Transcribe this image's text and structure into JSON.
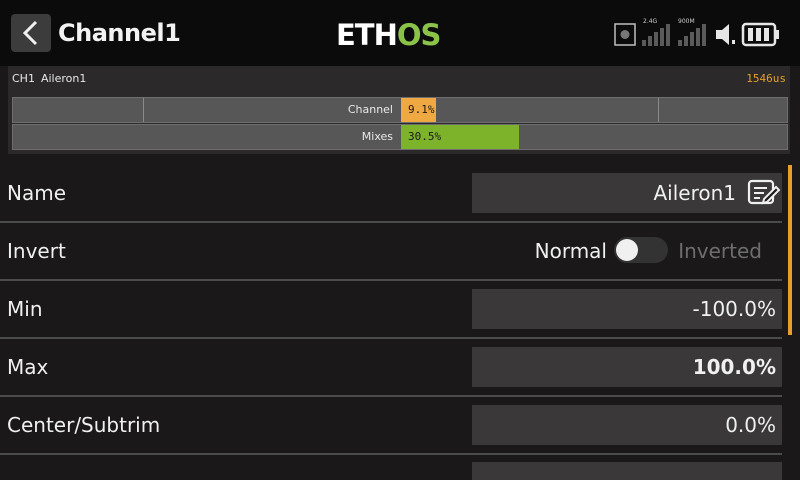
{
  "header": {
    "title": "Channel1",
    "logo": {
      "text": "ETHOS",
      "eth": "ETH",
      "os": "OS"
    },
    "status": {
      "rf_label": "2.4G",
      "rf2_label": "900M"
    }
  },
  "monitor": {
    "channel": "CH1",
    "name": "Aileron1",
    "output_us": "1546us",
    "bars": [
      {
        "label": "Channel",
        "value": "9.1%",
        "fraction": 0.091,
        "color": "#f0a842"
      },
      {
        "label": "Mixes",
        "value": "30.5%",
        "fraction": 0.305,
        "color": "#7db32a"
      }
    ]
  },
  "form": {
    "name": {
      "label": "Name",
      "value": "Aileron1"
    },
    "invert": {
      "label": "Invert",
      "off_label": "Normal",
      "on_label": "Inverted",
      "state": false
    },
    "min": {
      "label": "Min",
      "value": "-100.0%"
    },
    "max": {
      "label": "Max",
      "value": "100.0%"
    },
    "center": {
      "label": "Center/Subtrim",
      "value": "0.0%"
    }
  },
  "colors": {
    "accent_orange": "#e59f2a",
    "accent_green": "#7db32a",
    "background": "#1a1818"
  },
  "icons": [
    "back-chevron-icon",
    "edit-icon",
    "rf-signal-icon",
    "speaker-icon",
    "battery-icon"
  ]
}
